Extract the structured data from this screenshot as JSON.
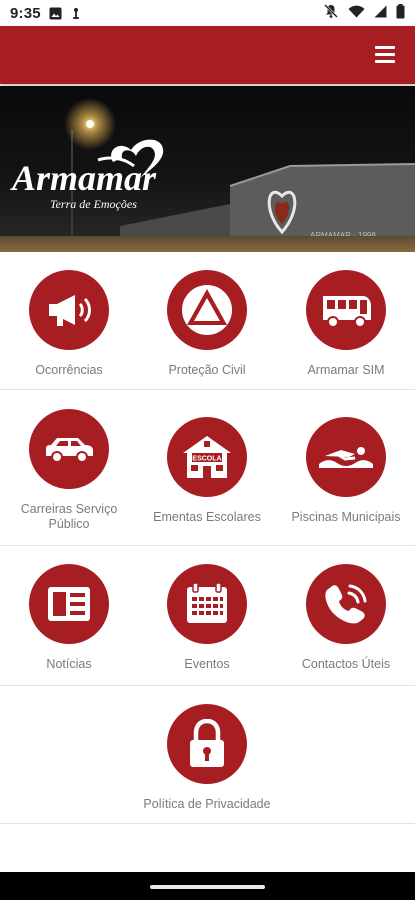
{
  "status_bar": {
    "time": "9:35",
    "icons": [
      "photo-notification-icon",
      "broadcast-notification-icon",
      "mute-icon",
      "wifi-icon",
      "signal-icon",
      "battery-icon"
    ]
  },
  "app_bar": {
    "menu_icon": "hamburger-menu-icon",
    "color": "#a71e22"
  },
  "banner": {
    "logo_text": "Armamar",
    "tagline": "Terra de Emoções"
  },
  "menu": {
    "items": [
      {
        "label": "Ocorrências",
        "icon": "megaphone-icon"
      },
      {
        "label": "Proteção Civil",
        "icon": "civil-protection-triangle-icon"
      },
      {
        "label": "Armamar SIM",
        "icon": "bus-icon"
      },
      {
        "label": "Carreiras Serviço Público",
        "icon": "car-icon"
      },
      {
        "label": "Ementas Escolares",
        "icon": "school-icon"
      },
      {
        "label": "Piscinas Municipais",
        "icon": "swimmer-icon"
      },
      {
        "label": "Notícias",
        "icon": "newspaper-icon"
      },
      {
        "label": "Eventos",
        "icon": "calendar-icon"
      },
      {
        "label": "Contactos Úteis",
        "icon": "phone-icon"
      },
      {
        "label": "Política de Privacidade",
        "icon": "padlock-icon"
      }
    ]
  },
  "school_sign": "ESCOLA",
  "colors": {
    "primary": "#a71e22",
    "label": "#7a7a7a",
    "divider": "#e2e2e2"
  }
}
